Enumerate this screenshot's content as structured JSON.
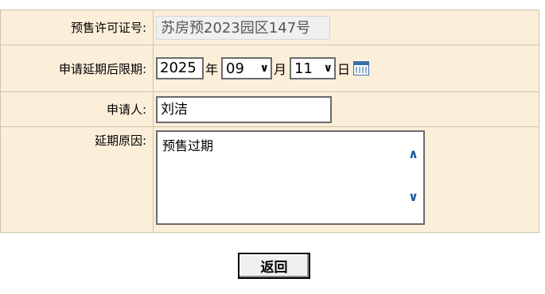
{
  "form": {
    "presale_permit": {
      "label": "预售许可证号:",
      "value": "苏房预2023园区147号"
    },
    "extension_deadline": {
      "label": "申请延期后限期:",
      "year": "2025",
      "year_unit": "年",
      "month": "09",
      "month_unit": "月",
      "day": "11",
      "day_unit": "日"
    },
    "applicant": {
      "label": "申请人:",
      "value": "刘洁"
    },
    "reason": {
      "label": "延期原因:",
      "value": "预售过期"
    }
  },
  "buttons": {
    "back_label": "返回"
  },
  "icons": {
    "calendar": "calendar-icon",
    "scroll_up": "chevron-up-icon",
    "scroll_down": "chevron-down-icon",
    "dropdown": "chevron-down-icon"
  },
  "colors": {
    "row_background": "#fcefd9",
    "cell_border": "#cfc3aa",
    "accent": "#1f5a96"
  }
}
